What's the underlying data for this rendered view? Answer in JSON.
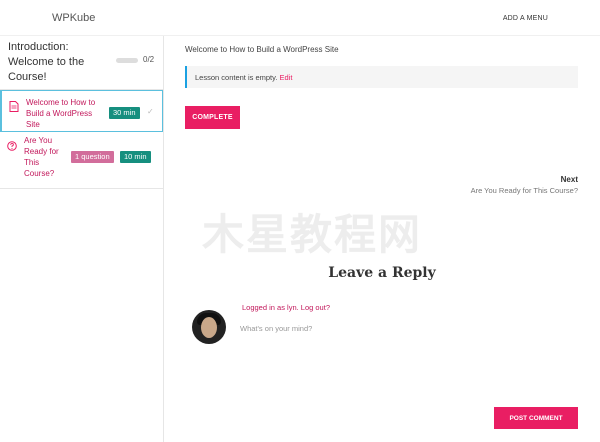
{
  "header": {
    "logo": "WPKube",
    "add_menu": "ADD A MENU"
  },
  "sidebar": {
    "section_title": "Introduction: Welcome to the Course!",
    "section_count": "0/2",
    "lessons": [
      {
        "title": "Welcome to How to Build a WordPress Site",
        "duration": "30 min",
        "icon": "document-icon",
        "active": true
      },
      {
        "title": "Are You Ready for This Course?",
        "questions": "1 question",
        "duration": "10 min",
        "icon": "quiz-icon",
        "active": false
      }
    ]
  },
  "main": {
    "lesson_heading": "Welcome to How to Build a WordPress Site",
    "notice_text": "Lesson content is empty.",
    "notice_edit": "Edit",
    "complete_label": "COMPLETE",
    "next_label": "Next",
    "next_title": "Are You Ready for This Course?",
    "watermark": "木星教程网",
    "reply_title": "Leave a Reply",
    "logged_in": "Logged in as lyn. Log out?",
    "comment_placeholder": "What's on your mind?",
    "post_label": "POST COMMENT"
  },
  "colors": {
    "accent": "#e91e63",
    "teal_badge": "#168f7f",
    "pink_badge": "#d26d9b",
    "info_border": "#1ba1e2"
  }
}
